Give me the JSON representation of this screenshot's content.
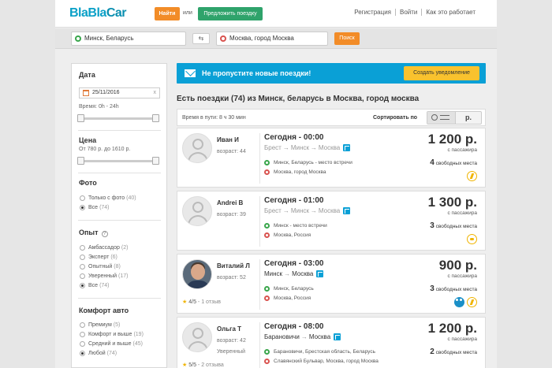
{
  "header": {
    "logo": {
      "part1": "Bla",
      "part2": "Bla",
      "part3": "Car"
    },
    "find_label": "Найти",
    "or_label": "или",
    "offer_label": "Предложить поездку",
    "links": [
      "Регистрация",
      "Войти",
      "Как это работает"
    ]
  },
  "search": {
    "from": "Минск, Беларусь",
    "to": "Москва, город Москва",
    "button": "Поиск"
  },
  "sidebar": {
    "date_title": "Дата",
    "date_value": "25/11/2016",
    "time_label": "Время: 0h - 24h",
    "price_title": "Цена",
    "price_label": "От 780 р. до 1610 р.",
    "photo_title": "Фото",
    "photo_options": [
      {
        "label": "Только с фото",
        "count": "(40)",
        "selected": false
      },
      {
        "label": "Все",
        "count": "(74)",
        "selected": true
      }
    ],
    "exp_title": "Опыт",
    "exp_options": [
      {
        "label": "Амбассадор",
        "count": "(2)",
        "selected": false
      },
      {
        "label": "Эксперт",
        "count": "(6)",
        "selected": false
      },
      {
        "label": "Опытный",
        "count": "(8)",
        "selected": false
      },
      {
        "label": "Уверенный",
        "count": "(17)",
        "selected": false
      },
      {
        "label": "Все",
        "count": "(74)",
        "selected": true
      }
    ],
    "comfort_title": "Комфорт авто",
    "comfort_options": [
      {
        "label": "Премиум",
        "count": "(5)",
        "selected": false
      },
      {
        "label": "Комфорт и выше",
        "count": "(19)",
        "selected": false
      },
      {
        "label": "Средний и выше",
        "count": "(45)",
        "selected": false
      },
      {
        "label": "Любой",
        "count": "(74)",
        "selected": true
      }
    ]
  },
  "banner": {
    "text": "Не пропустите новые поездки!",
    "button": "Создать уведомление"
  },
  "results": {
    "title": "Есть поездки (74) из Минск, беларусь в Москва, город москва",
    "duration": "Время в пути: 8 ч 30 мин",
    "sort_label": "Сортировать по",
    "sort_price": "р."
  },
  "trips": [
    {
      "driver": "Иван И",
      "age": "возраст: 44",
      "level": "",
      "rating": "",
      "reviews": "",
      "when": "Сегодня - 00:00",
      "route_from": "Брест",
      "route_mid": "Минск",
      "route_to": "Москва",
      "from_faded": true,
      "stop1": "Минск, Беларусь - место встречи",
      "stop2": "Москва, город Москва",
      "price": "1 200 р.",
      "per": "с пассажира",
      "seats_n": "4",
      "seats_t": "свободных места",
      "icons": [
        "bolt"
      ]
    },
    {
      "driver": "Andrei B",
      "age": "возраст: 39",
      "level": "",
      "rating": "",
      "reviews": "",
      "when": "Сегодня - 01:00",
      "route_from": "Брест",
      "route_mid": "Минск",
      "route_to": "Москва",
      "from_faded": true,
      "stop1": "Минск - место встречи",
      "stop2": "Москва, Россия",
      "price": "1 300 р.",
      "per": "с пассажира",
      "seats_n": "3",
      "seats_t": "свободных места",
      "icons": [
        "pet"
      ]
    },
    {
      "driver": "Виталий Л",
      "age": "возраст: 52",
      "level": "",
      "rating": "4/5",
      "reviews": "- 1 отзыв",
      "when": "Сегодня - 03:00",
      "route_from": "",
      "route_mid": "Минск",
      "route_to": "Москва",
      "from_faded": false,
      "stop1": "Минск, Беларусь",
      "stop2": "Москва, Россия",
      "price": "900 р.",
      "per": "с пассажира",
      "seats_n": "3",
      "seats_t": "свободных места",
      "icons": [
        "ladies",
        "bolt"
      ]
    },
    {
      "driver": "Ольга Т",
      "age": "возраст: 42",
      "level": "Уверенный",
      "rating": "5/5",
      "reviews": "- 2 отзыва",
      "when": "Сегодня - 08:00",
      "route_from": "",
      "route_mid": "Барановичи",
      "route_to": "Москва",
      "from_faded": false,
      "stop1": "Барановичи, Брестская область, Беларусь",
      "stop2": "Славянский Бульвар, Москва, город Москва",
      "price": "1 200 р.",
      "per": "с пассажира",
      "seats_n": "2",
      "seats_t": "свободных места",
      "icons": []
    }
  ],
  "colors": {
    "orange": "#f28c28",
    "green": "#2fa36b",
    "blue": "#0aa0d6",
    "yellow": "#f9c22e"
  }
}
